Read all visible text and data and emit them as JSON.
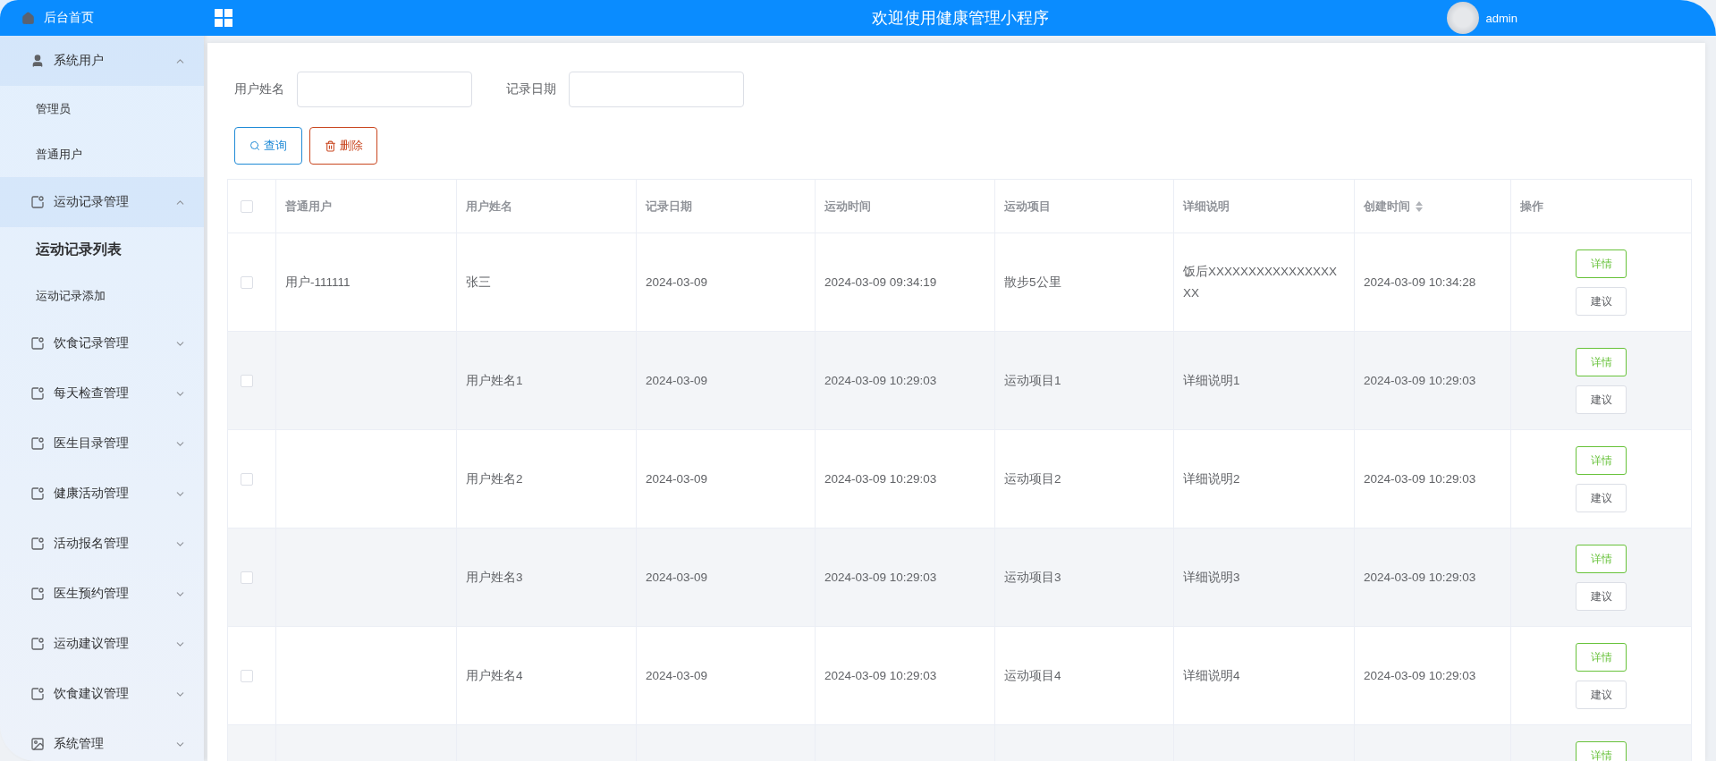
{
  "header": {
    "title": "欢迎使用健康管理小程序",
    "user": "admin"
  },
  "sidebar": {
    "home": "后台首页",
    "groups": [
      {
        "kind": "user",
        "label": "系统用户",
        "expanded": true,
        "children": [
          {
            "label": "管理员",
            "selected": false
          },
          {
            "label": "普通用户",
            "selected": false
          }
        ]
      },
      {
        "kind": "note",
        "label": "运动记录管理",
        "expanded": true,
        "children": [
          {
            "label": "运动记录列表",
            "selected": true
          },
          {
            "label": "运动记录添加",
            "selected": false
          }
        ]
      },
      {
        "kind": "note",
        "label": "饮食记录管理",
        "expanded": false
      },
      {
        "kind": "note",
        "label": "每天检查管理",
        "expanded": false
      },
      {
        "kind": "note",
        "label": "医生目录管理",
        "expanded": false
      },
      {
        "kind": "note",
        "label": "健康活动管理",
        "expanded": false
      },
      {
        "kind": "note",
        "label": "活动报名管理",
        "expanded": false
      },
      {
        "kind": "note",
        "label": "医生预约管理",
        "expanded": false
      },
      {
        "kind": "note",
        "label": "运动建议管理",
        "expanded": false
      },
      {
        "kind": "note",
        "label": "饮食建议管理",
        "expanded": false
      },
      {
        "kind": "image",
        "label": "系统管理",
        "expanded": false
      }
    ]
  },
  "filters": [
    {
      "label": "用户姓名"
    },
    {
      "label": "记录日期"
    }
  ],
  "buttons": [
    {
      "kind": "search",
      "label": "查询"
    },
    {
      "kind": "delete",
      "label": "删除"
    }
  ],
  "table": {
    "all_checked": false,
    "columns": [
      {
        "label": "普通用户",
        "sortable": false
      },
      {
        "label": "用户姓名",
        "sortable": false
      },
      {
        "label": "记录日期",
        "sortable": false
      },
      {
        "label": "运动时间",
        "sortable": false
      },
      {
        "label": "运动项目",
        "sortable": false
      },
      {
        "label": "详细说明",
        "sortable": false
      },
      {
        "label": "创建时间",
        "sortable": true
      },
      {
        "label": "操作",
        "sortable": false
      }
    ],
    "rows": [
      {
        "checked": false,
        "cells": [
          "用户-111111",
          "张三",
          "2024-03-09",
          "2024-03-09 09:34:19",
          "散步5公里",
          "饭后XXXXXXXXXXXXXXXXXX",
          "2024-03-09 10:34:28"
        ],
        "actions": [
          {
            "kind": "detail",
            "label": "详情"
          },
          {
            "kind": "advice",
            "label": "建议"
          }
        ]
      },
      {
        "checked": false,
        "cells": [
          null,
          "用户姓名1",
          "2024-03-09",
          "2024-03-09 10:29:03",
          "运动项目1",
          "详细说明1",
          "2024-03-09 10:29:03"
        ],
        "actions": [
          {
            "kind": "detail",
            "label": "详情"
          },
          {
            "kind": "advice",
            "label": "建议"
          }
        ]
      },
      {
        "checked": false,
        "cells": [
          null,
          "用户姓名2",
          "2024-03-09",
          "2024-03-09 10:29:03",
          "运动项目2",
          "详细说明2",
          "2024-03-09 10:29:03"
        ],
        "actions": [
          {
            "kind": "detail",
            "label": "详情"
          },
          {
            "kind": "advice",
            "label": "建议"
          }
        ]
      },
      {
        "checked": false,
        "cells": [
          null,
          "用户姓名3",
          "2024-03-09",
          "2024-03-09 10:29:03",
          "运动项目3",
          "详细说明3",
          "2024-03-09 10:29:03"
        ],
        "actions": [
          {
            "kind": "detail",
            "label": "详情"
          },
          {
            "kind": "advice",
            "label": "建议"
          }
        ]
      },
      {
        "checked": false,
        "cells": [
          null,
          "用户姓名4",
          "2024-03-09",
          "2024-03-09 10:29:03",
          "运动项目4",
          "详细说明4",
          "2024-03-09 10:29:03"
        ],
        "actions": [
          {
            "kind": "detail",
            "label": "详情"
          },
          {
            "kind": "advice",
            "label": "建议"
          }
        ]
      },
      {
        "actions": [
          {
            "kind": "detail",
            "label": "详情"
          }
        ]
      }
    ]
  }
}
